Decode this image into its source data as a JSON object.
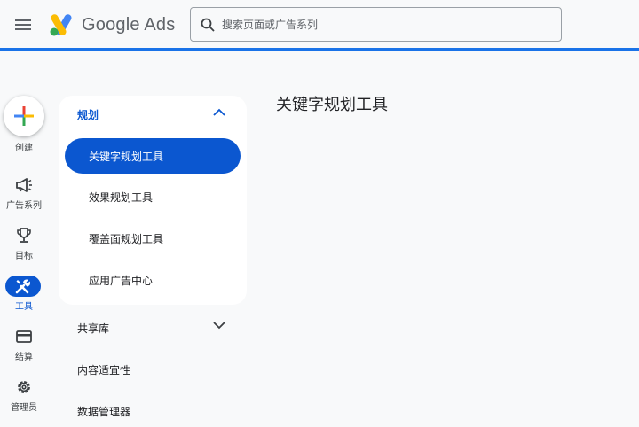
{
  "header": {
    "app_name": "Google Ads",
    "search_placeholder": "搜索页面或广告系列"
  },
  "rail": {
    "create_label": "创建",
    "items": [
      {
        "label": "广告系列",
        "icon": "megaphone-icon"
      },
      {
        "label": "目标",
        "icon": "trophy-icon"
      },
      {
        "label": "工具",
        "icon": "tools-icon",
        "active": true
      },
      {
        "label": "结算",
        "icon": "credit-card-icon"
      },
      {
        "label": "管理员",
        "icon": "gear-icon"
      }
    ]
  },
  "nav": {
    "section_label": "规划",
    "items": [
      {
        "label": "关键字规划工具",
        "active": true
      },
      {
        "label": "效果规划工具"
      },
      {
        "label": "覆盖面规划工具"
      },
      {
        "label": "应用广告中心"
      }
    ],
    "other_sections": [
      {
        "label": "共享库",
        "expandable": true
      },
      {
        "label": "内容适宜性"
      },
      {
        "label": "数据管理器"
      }
    ]
  },
  "main": {
    "title": "关键字规划工具"
  },
  "colors": {
    "accent": "#0b57d0",
    "header_line": "#1a73e8"
  }
}
